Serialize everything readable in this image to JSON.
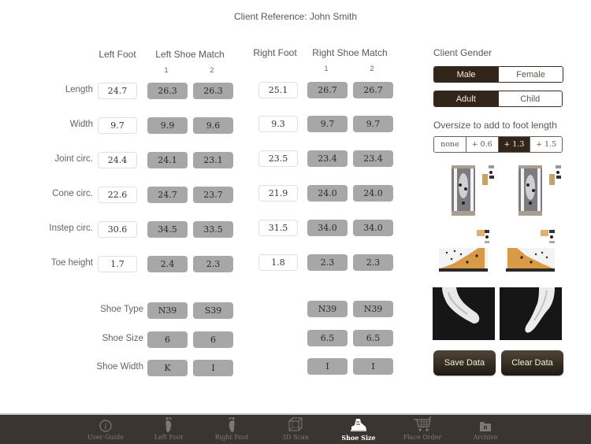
{
  "header": {
    "title": "Client Reference: John Smith"
  },
  "left": {
    "foot_header": "Left Foot",
    "match_header": "Left Shoe Match",
    "match_sub": [
      "1",
      "2"
    ]
  },
  "right": {
    "foot_header": "Right Foot",
    "match_header": "Right Shoe Match",
    "match_sub": [
      "1",
      "2"
    ]
  },
  "measurements": [
    {
      "label": "Length",
      "left_foot": "24.7",
      "left_match": [
        "26.3",
        "26.3"
      ],
      "right_foot": "25.1",
      "right_match": [
        "26.7",
        "26.7"
      ]
    },
    {
      "label": "Width",
      "left_foot": "9.7",
      "left_match": [
        "9.9",
        "9.6"
      ],
      "right_foot": "9.3",
      "right_match": [
        "9.7",
        "9.7"
      ]
    },
    {
      "label": "Joint circ.",
      "left_foot": "24.4",
      "left_match": [
        "24.1",
        "23.1"
      ],
      "right_foot": "23.5",
      "right_match": [
        "23.4",
        "23.4"
      ]
    },
    {
      "label": "Cone circ.",
      "left_foot": "22.6",
      "left_match": [
        "24.7",
        "23.7"
      ],
      "right_foot": "21.9",
      "right_match": [
        "24.0",
        "24.0"
      ]
    },
    {
      "label": "Instep circ.",
      "left_foot": "30.6",
      "left_match": [
        "34.5",
        "33.5"
      ],
      "right_foot": "31.5",
      "right_match": [
        "34.0",
        "34.0"
      ]
    },
    {
      "label": "Toe height",
      "left_foot": "1.7",
      "left_match": [
        "2.4",
        "2.3"
      ],
      "right_foot": "1.8",
      "right_match": [
        "2.3",
        "2.3"
      ]
    }
  ],
  "shoe": [
    {
      "label": "Shoe Type",
      "left": [
        "N39",
        "S39"
      ],
      "right": [
        "N39",
        "N39"
      ]
    },
    {
      "label": "Shoe Size",
      "left": [
        "6",
        "6"
      ],
      "right": [
        "6.5",
        "6.5"
      ]
    },
    {
      "label": "Shoe Width",
      "left": [
        "K",
        "I"
      ],
      "right": [
        "I",
        "I"
      ]
    }
  ],
  "panel": {
    "gender_label": "Client Gender",
    "gender_options": [
      "Male",
      "Female"
    ],
    "gender_selected": "Male",
    "age_options": [
      "Adult",
      "Child"
    ],
    "age_selected": "Adult",
    "oversize_label": "Oversize to add to foot length",
    "oversize_options": [
      "none",
      "+ 0.6",
      "+ 1.3",
      "+ 1.5"
    ],
    "oversize_selected": "+ 1.3",
    "save_label": "Save Data",
    "clear_label": "Clear Data"
  },
  "tabs": [
    {
      "label": "User Guide",
      "icon": "info-icon"
    },
    {
      "label": "Left Foot",
      "icon": "left-foot-icon"
    },
    {
      "label": "Right Foot",
      "icon": "right-foot-icon"
    },
    {
      "label": "3D Scan",
      "icon": "cube-icon"
    },
    {
      "label": "Shoe Size",
      "icon": "shoe-icon",
      "active": true
    },
    {
      "label": "Place Order",
      "icon": "cart-icon"
    },
    {
      "label": "Archive",
      "icon": "archive-icon"
    }
  ],
  "colors": {
    "accent": "#32261b",
    "match_fill": "#a7a7a7",
    "tabbar": "#3a3531"
  }
}
